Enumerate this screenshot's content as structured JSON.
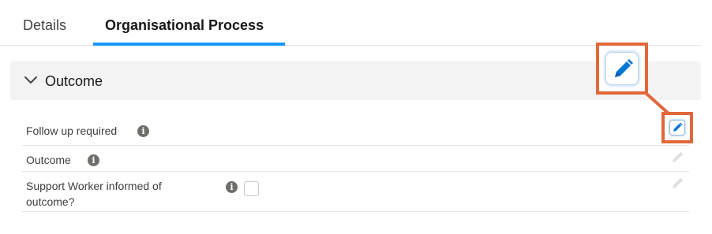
{
  "tabs": [
    {
      "label": "Details",
      "active": false
    },
    {
      "label": "Organisational Process",
      "active": true
    }
  ],
  "section": {
    "title": "Outcome",
    "expanded": true
  },
  "fields": [
    {
      "label": "Follow up required"
    },
    {
      "label": "Outcome"
    },
    {
      "label": "Support Worker informed of outcome?",
      "checked": false
    }
  ],
  "info_icon_glyph": "i",
  "colors": {
    "accent": "#1b96ff",
    "edit_icon": "#0176d3",
    "highlight": "#e0683a",
    "section_bg": "#f3f3f3"
  },
  "icons": [
    "chevron-down-icon",
    "info-icon",
    "pencil-icon"
  ]
}
